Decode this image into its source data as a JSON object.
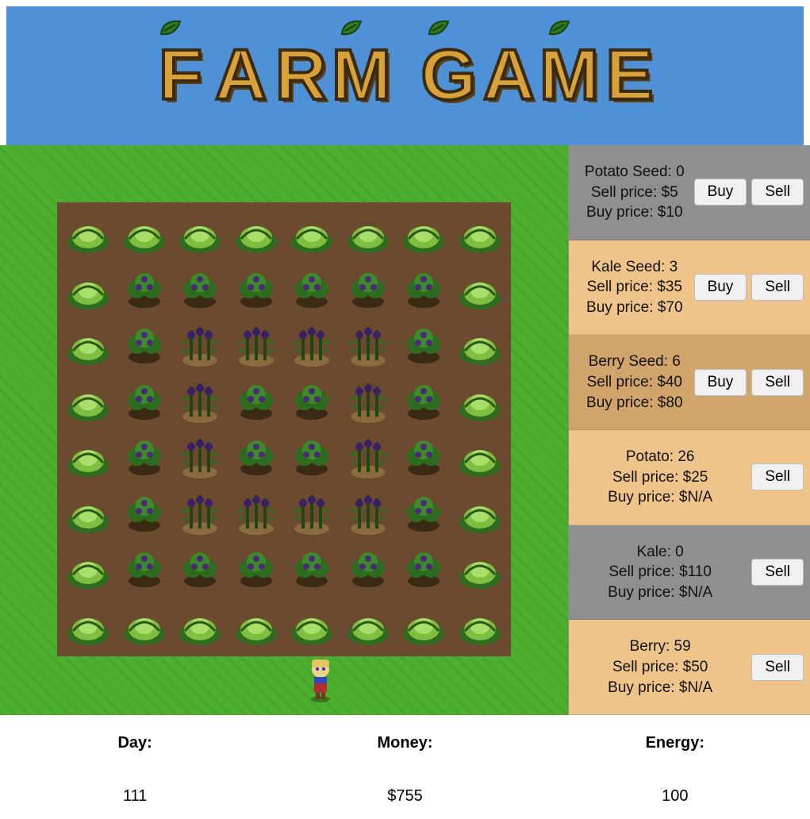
{
  "title_words": [
    "FARM",
    "GAME"
  ],
  "shop": [
    {
      "name": "Potato Seed",
      "qty": 0,
      "sell": "$5",
      "buy": "$10",
      "can_buy": true,
      "style": "disabled"
    },
    {
      "name": "Kale Seed",
      "qty": 3,
      "sell": "$35",
      "buy": "$70",
      "can_buy": true,
      "style": "alt1"
    },
    {
      "name": "Berry Seed",
      "qty": 6,
      "sell": "$40",
      "buy": "$80",
      "can_buy": true,
      "style": "alt2"
    },
    {
      "name": "Potato",
      "qty": 26,
      "sell": "$25",
      "buy": "$N/A",
      "can_buy": false,
      "style": "alt1"
    },
    {
      "name": "Kale",
      "qty": 0,
      "sell": "$110",
      "buy": "$N/A",
      "can_buy": false,
      "style": "disabled"
    },
    {
      "name": "Berry",
      "qty": 59,
      "sell": "$50",
      "buy": "$N/A",
      "can_buy": false,
      "style": "alt1"
    }
  ],
  "labels": {
    "sell_price": "Sell price:",
    "buy_price": "Buy price:",
    "buy": "Buy",
    "sell": "Sell"
  },
  "status": {
    "day_label": "Day:",
    "money_label": "Money:",
    "energy_label": "Energy:",
    "day": "111",
    "money": "$755",
    "energy": "100"
  },
  "field": {
    "rows": 8,
    "cols": 8,
    "plots": [
      [
        "cabbage",
        "cabbage",
        "cabbage",
        "cabbage",
        "cabbage",
        "cabbage",
        "cabbage",
        "cabbage"
      ],
      [
        "cabbage",
        "bush",
        "bush",
        "bush",
        "bush",
        "bush",
        "bush",
        "cabbage"
      ],
      [
        "cabbage",
        "bush",
        "stalk",
        "stalk",
        "stalk",
        "stalk",
        "bush",
        "cabbage"
      ],
      [
        "cabbage",
        "bush",
        "stalk",
        "bush",
        "bush",
        "stalk",
        "bush",
        "cabbage"
      ],
      [
        "cabbage",
        "bush",
        "stalk",
        "bush",
        "bush",
        "stalk",
        "bush",
        "cabbage"
      ],
      [
        "cabbage",
        "bush",
        "stalk",
        "stalk",
        "stalk",
        "stalk",
        "bush",
        "cabbage"
      ],
      [
        "cabbage",
        "bush",
        "bush",
        "bush",
        "bush",
        "bush",
        "bush",
        "cabbage"
      ],
      [
        "cabbage",
        "cabbage",
        "cabbage",
        "cabbage",
        "cabbage",
        "cabbage",
        "cabbage",
        "cabbage"
      ]
    ]
  }
}
